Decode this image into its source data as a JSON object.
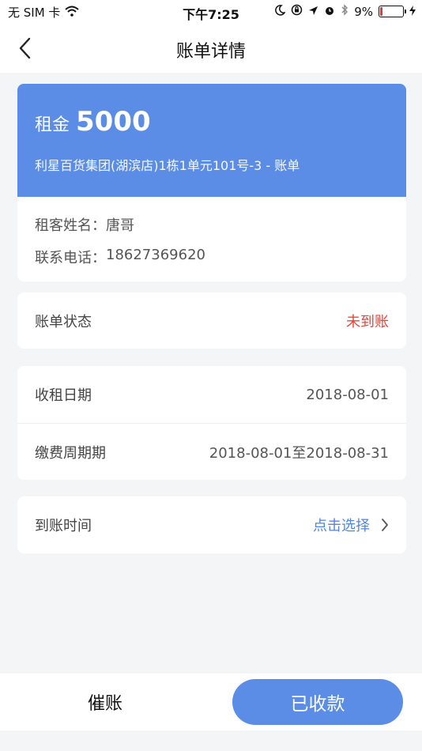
{
  "status_bar": {
    "carrier": "无 SIM 卡",
    "time": "下午7:25",
    "battery_text": "9%",
    "battery_level": 0.09
  },
  "nav": {
    "title": "账单详情"
  },
  "rent_card": {
    "label": "租金",
    "amount": "5000",
    "address": "利星百货集团(湖滨店)1栋1单元101号-3 - 账单",
    "tenant_name_label": "租客姓名：",
    "tenant_name": "唐哥",
    "tenant_phone_label": "联系电话：",
    "tenant_phone": "18627369620"
  },
  "bill_status": {
    "label": "账单状态",
    "value": "未到账"
  },
  "dates": {
    "collection_label": "收租日期",
    "collection_value": "2018-08-01",
    "period_label": "缴费周期期",
    "period_value": "2018-08-01至2018-08-31"
  },
  "arrival": {
    "label": "到账时间",
    "value": "点击选择"
  },
  "actions": {
    "remind_label": "催账",
    "received_label": "已收款"
  },
  "colors": {
    "accent": "#5b8ce6",
    "status_red": "#e8443a",
    "link_blue": "#4f86e0"
  }
}
